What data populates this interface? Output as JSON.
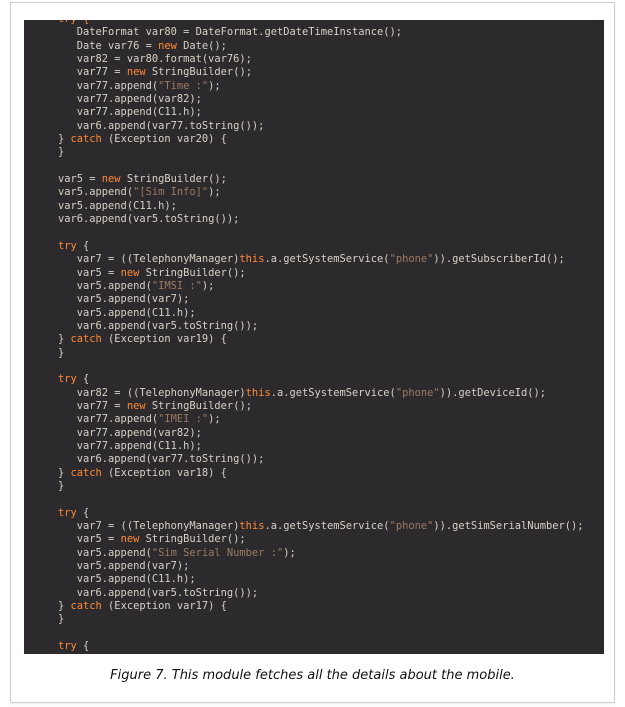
{
  "code_lines": [
    [
      [
        "kw",
        "try {"
      ]
    ],
    [
      [
        "t",
        "   DateFormat var80 = DateFormat.getDateTimeInstance();"
      ]
    ],
    [
      [
        "t",
        "   Date var76 = "
      ],
      [
        "kw",
        "new"
      ],
      [
        "t",
        " Date();"
      ]
    ],
    [
      [
        "t",
        "   var82 = var80.format(var76);"
      ]
    ],
    [
      [
        "t",
        "   var77 = "
      ],
      [
        "kw",
        "new"
      ],
      [
        "t",
        " StringBuilder();"
      ]
    ],
    [
      [
        "t",
        "   var77.append("
      ],
      [
        "str",
        "\"Time :\""
      ],
      [
        "t",
        ");"
      ]
    ],
    [
      [
        "t",
        "   var77.append(var82);"
      ]
    ],
    [
      [
        "t",
        "   var77.append(C11.h);"
      ]
    ],
    [
      [
        "t",
        "   var6.append(var77.toString());"
      ]
    ],
    [
      [
        "t",
        "} "
      ],
      [
        "kw",
        "catch"
      ],
      [
        "t",
        " (Exception var20) {"
      ]
    ],
    [
      [
        "t",
        "}"
      ]
    ],
    [
      [
        "t",
        ""
      ]
    ],
    [
      [
        "t",
        "var5 = "
      ],
      [
        "kw",
        "new"
      ],
      [
        "t",
        " StringBuilder();"
      ]
    ],
    [
      [
        "t",
        "var5.append("
      ],
      [
        "str",
        "\"[Sim Info]\""
      ],
      [
        "t",
        ");"
      ]
    ],
    [
      [
        "t",
        "var5.append(C11.h);"
      ]
    ],
    [
      [
        "t",
        "var6.append(var5.toString());"
      ]
    ],
    [
      [
        "t",
        ""
      ]
    ],
    [
      [
        "kw",
        "try"
      ],
      [
        "t",
        " {"
      ]
    ],
    [
      [
        "t",
        "   var7 = ((TelephonyManager)"
      ],
      [
        "kw",
        "this"
      ],
      [
        "t",
        ".a.getSystemService("
      ],
      [
        "str",
        "\"phone\""
      ],
      [
        "t",
        ")).getSubscriberId();"
      ]
    ],
    [
      [
        "t",
        "   var5 = "
      ],
      [
        "kw",
        "new"
      ],
      [
        "t",
        " StringBuilder();"
      ]
    ],
    [
      [
        "t",
        "   var5.append("
      ],
      [
        "str",
        "\"IMSI :\""
      ],
      [
        "t",
        ");"
      ]
    ],
    [
      [
        "t",
        "   var5.append(var7);"
      ]
    ],
    [
      [
        "t",
        "   var5.append(C11.h);"
      ]
    ],
    [
      [
        "t",
        "   var6.append(var5.toString());"
      ]
    ],
    [
      [
        "t",
        "} "
      ],
      [
        "kw",
        "catch"
      ],
      [
        "t",
        " (Exception var19) {"
      ]
    ],
    [
      [
        "t",
        "}"
      ]
    ],
    [
      [
        "t",
        ""
      ]
    ],
    [
      [
        "kw",
        "try"
      ],
      [
        "t",
        " {"
      ]
    ],
    [
      [
        "t",
        "   var82 = ((TelephonyManager)"
      ],
      [
        "kw",
        "this"
      ],
      [
        "t",
        ".a.getSystemService("
      ],
      [
        "str",
        "\"phone\""
      ],
      [
        "t",
        ")).getDeviceId();"
      ]
    ],
    [
      [
        "t",
        "   var77 = "
      ],
      [
        "kw",
        "new"
      ],
      [
        "t",
        " StringBuilder();"
      ]
    ],
    [
      [
        "t",
        "   var77.append("
      ],
      [
        "str",
        "\"IMEI :\""
      ],
      [
        "t",
        ");"
      ]
    ],
    [
      [
        "t",
        "   var77.append(var82);"
      ]
    ],
    [
      [
        "t",
        "   var77.append(C11.h);"
      ]
    ],
    [
      [
        "t",
        "   var6.append(var77.toString());"
      ]
    ],
    [
      [
        "t",
        "} "
      ],
      [
        "kw",
        "catch"
      ],
      [
        "t",
        " (Exception var18) {"
      ]
    ],
    [
      [
        "t",
        "}"
      ]
    ],
    [
      [
        "t",
        ""
      ]
    ],
    [
      [
        "kw",
        "try"
      ],
      [
        "t",
        " {"
      ]
    ],
    [
      [
        "t",
        "   var7 = ((TelephonyManager)"
      ],
      [
        "kw",
        "this"
      ],
      [
        "t",
        ".a.getSystemService("
      ],
      [
        "str",
        "\"phone\""
      ],
      [
        "t",
        ")).getSimSerialNumber();"
      ]
    ],
    [
      [
        "t",
        "   var5 = "
      ],
      [
        "kw",
        "new"
      ],
      [
        "t",
        " StringBuilder();"
      ]
    ],
    [
      [
        "t",
        "   var5.append("
      ],
      [
        "str",
        "\"Sim Serial Number :\""
      ],
      [
        "t",
        ");"
      ]
    ],
    [
      [
        "t",
        "   var5.append(var7);"
      ]
    ],
    [
      [
        "t",
        "   var5.append(C11.h);"
      ]
    ],
    [
      [
        "t",
        "   var6.append(var5.toString());"
      ]
    ],
    [
      [
        "t",
        "} "
      ],
      [
        "kw",
        "catch"
      ],
      [
        "t",
        " (Exception var17) {"
      ]
    ],
    [
      [
        "t",
        "}"
      ]
    ],
    [
      [
        "t",
        ""
      ]
    ],
    [
      [
        "kw",
        "try"
      ],
      [
        "t",
        " {"
      ]
    ]
  ],
  "caption": "Figure 7. This module fetches all the details about the mobile.",
  "colors": {
    "background": "#2d2a2e",
    "text": "#d8d0c4",
    "keyword": "#ff8a36",
    "string": "#9a7a62"
  }
}
